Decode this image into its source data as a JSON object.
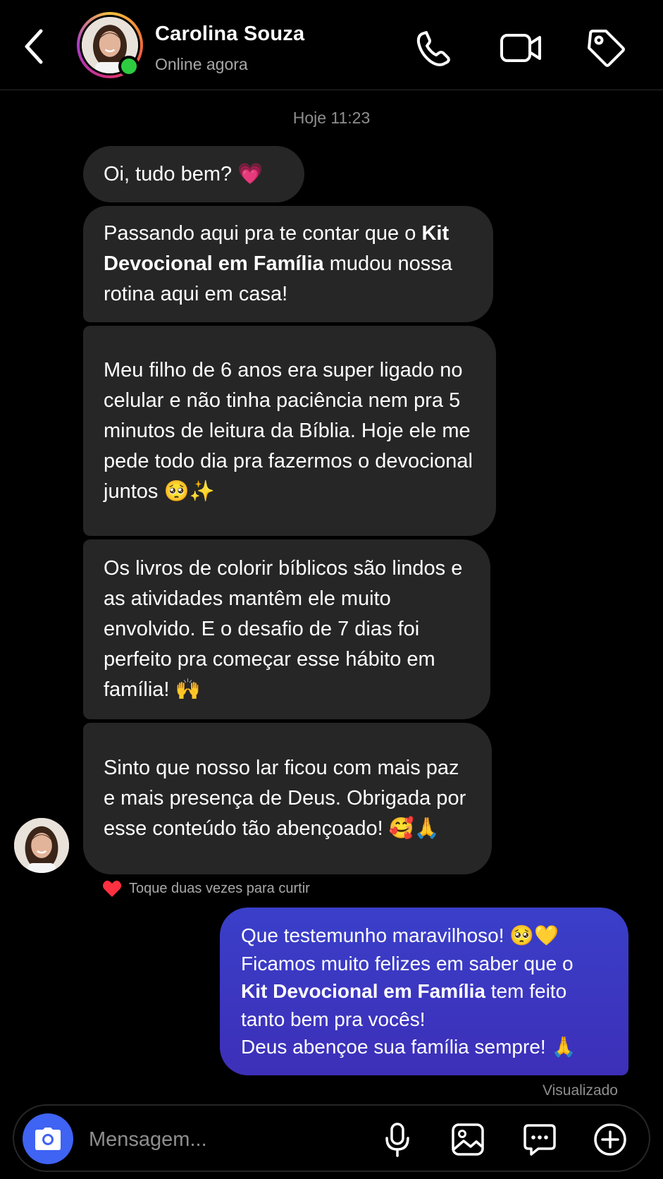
{
  "header": {
    "name": "Carolina Souza",
    "status": "Online agora",
    "icons": [
      "back-icon",
      "phone-icon",
      "video-camera-icon",
      "tag-icon"
    ]
  },
  "conversation": {
    "timestamp": "Hoje 11:23",
    "incoming": [
      {
        "text": "Oi, tudo bem? 💗"
      },
      {
        "pre": "Passando aqui pra te contar que o ",
        "bold": "Kit Devocional em Família",
        "post": " mudou nossa rotina aqui em casa!"
      },
      {
        "text": "Meu filho de 6 anos era super ligado no celular e não tinha paciência nem pra 5 minutos de leitura da Bíblia. Hoje ele me pede todo dia pra fazermos o devocional juntos 🥺✨"
      },
      {
        "text": "Os livros de colorir bíblicos são lindos e as atividades mantêm ele muito envolvido. E o desafio de 7 dias foi perfeito pra começar esse hábito em família! 🙌"
      },
      {
        "text": "Sinto que nosso lar ficou com mais paz e mais presença de Deus. Obrigada por esse conteúdo tão abençoado! 🥰🙏"
      }
    ],
    "like_hint": "Toque duas vezes para curtir",
    "outgoing": {
      "line1": "Que testemunho maravilhoso! 🥺💛",
      "line2": "Ficamos muito felizes em saber que o",
      "bold": "Kit Devocional em Família",
      "line3_rest": " tem feito",
      "line4": "tanto bem pra vocês!",
      "line5": "Deus abençoe sua família sempre! 🙏"
    },
    "seen_label": "Visualizado"
  },
  "composer": {
    "placeholder": "Mensagem...",
    "icons": [
      "camera-icon",
      "microphone-icon",
      "gallery-icon",
      "chat-bubble-icon",
      "add-circle-icon"
    ]
  },
  "colors": {
    "background": "#000000",
    "incoming_bubble": "#262626",
    "outgoing_bubble": "#3a3fc9",
    "online": "#2ecc40",
    "camera_button": "#3f63f3"
  }
}
